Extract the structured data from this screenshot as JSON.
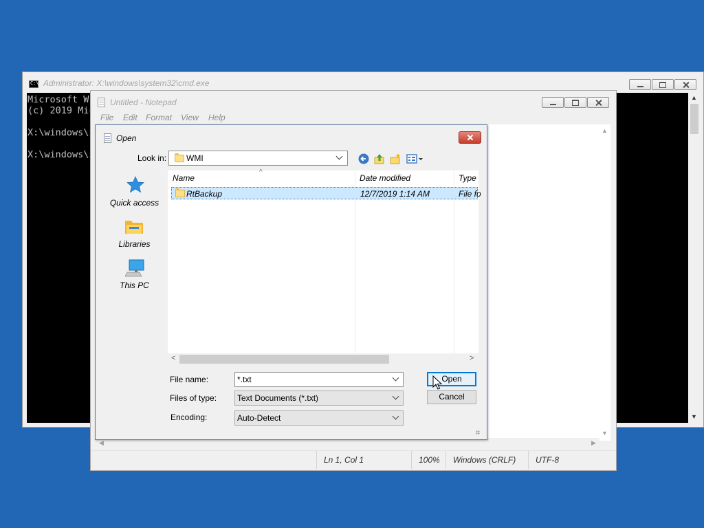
{
  "cmd": {
    "title": "Administrator: X:\\windows\\system32\\cmd.exe",
    "lines": [
      "Microsoft Wi",
      "(c) 2019 Mic",
      "",
      "X:\\windows\\s",
      "",
      "X:\\windows\\s"
    ]
  },
  "notepad": {
    "title": "Untitled - Notepad",
    "menu": [
      "File",
      "Edit",
      "Format",
      "View",
      "Help"
    ],
    "status": {
      "position": "Ln 1, Col 1",
      "zoom": "100%",
      "line_endings": "Windows (CRLF)",
      "encoding": "UTF-8"
    }
  },
  "open_dialog": {
    "title": "Open",
    "look_in_label": "Look in:",
    "look_in_value": "WMI",
    "places": [
      "Quick access",
      "Libraries",
      "This PC"
    ],
    "columns": [
      "Name",
      "Date modified",
      "Type"
    ],
    "rows": [
      {
        "name": "RtBackup",
        "date": "12/7/2019 1:14 AM",
        "type": "File fo"
      }
    ],
    "file_name_label": "File name:",
    "file_name_value": "*.txt",
    "files_of_type_label": "Files of type:",
    "files_of_type_value": "Text Documents (*.txt)",
    "encoding_label": "Encoding:",
    "encoding_value": "Auto-Detect",
    "open_button": "Open",
    "cancel_button": "Cancel"
  },
  "colors": {
    "desktop": "#2167b5",
    "selection": "#cce8ff",
    "accent": "#0078d7"
  },
  "icons": [
    "cmd-icon",
    "notepad-icon",
    "back-icon",
    "up-folder-icon",
    "new-folder-icon",
    "view-menu-icon",
    "quick-access-star-icon",
    "libraries-icon",
    "this-pc-icon",
    "folder-icon",
    "mouse-cursor-icon"
  ]
}
